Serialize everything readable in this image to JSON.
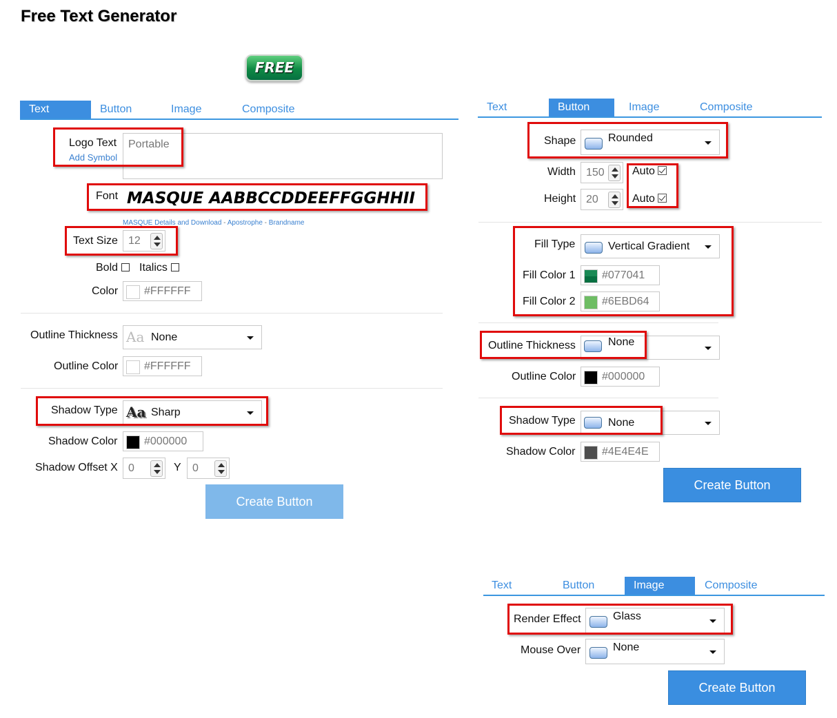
{
  "title": "Free Text Generator",
  "preview_badge": "FREE",
  "tabs": [
    "Text",
    "Button",
    "Image",
    "Composite"
  ],
  "text_panel": {
    "logo_text_label": "Logo Text",
    "add_symbol_link": "Add Symbol",
    "logo_text_value": "Portable",
    "font_label": "Font",
    "font_preview": "MASQUE AABBCCDDEEFFGGHHII",
    "font_link_details": "MASQUE Details and Download",
    "font_sep": " - ",
    "font_link_apostrophe": "Apostrophe",
    "font_link_brandname": "Brandname",
    "text_size_label": "Text Size",
    "text_size_value": "12",
    "bold_label": "Bold",
    "italics_label": "Italics",
    "color_label": "Color",
    "color_value": "#FFFFFF",
    "outline_thickness_label": "Outline Thickness",
    "outline_thickness_icon": "Aa",
    "outline_thickness_value": "None",
    "outline_color_label": "Outline Color",
    "outline_color_value": "#FFFFFF",
    "shadow_type_label": "Shadow Type",
    "shadow_type_icon": "Aa",
    "shadow_type_value": "Sharp",
    "shadow_color_label": "Shadow Color",
    "shadow_color_value": "#000000",
    "shadow_offset_x_label": "Shadow Offset X",
    "shadow_offset_x_value": "0",
    "shadow_offset_y_label": "Y",
    "shadow_offset_y_value": "0",
    "create_button": "Create Button"
  },
  "button_panel": {
    "shape_label": "Shape",
    "shape_value": "Rounded",
    "width_label": "Width",
    "width_value": "150",
    "height_label": "Height",
    "height_value": "20",
    "auto_label": "Auto",
    "fill_type_label": "Fill Type",
    "fill_type_value": "Vertical Gradient",
    "fill_color1_label": "Fill Color 1",
    "fill_color1_value": "#077041",
    "fill_color2_label": "Fill Color 2",
    "fill_color2_value": "#6EBD64",
    "outline_thickness_label": "Outline Thickness",
    "outline_thickness_value": "None",
    "outline_color_label": "Outline Color",
    "outline_color_value": "#000000",
    "shadow_type_label": "Shadow Type",
    "shadow_type_value": "None",
    "shadow_color_label": "Shadow Color",
    "shadow_color_value": "#4E4E4E",
    "create_button": "Create Button"
  },
  "image_panel": {
    "render_effect_label": "Render Effect",
    "render_effect_value": "Glass",
    "mouse_over_label": "Mouse Over",
    "mouse_over_value": "None",
    "create_button": "Create Button"
  },
  "colors": {
    "accent": "#3c8ee0",
    "highlight": "#e00b0b",
    "fill1": "#077041",
    "fill2": "#6EBD64",
    "shadow_button": "#4E4E4E"
  }
}
